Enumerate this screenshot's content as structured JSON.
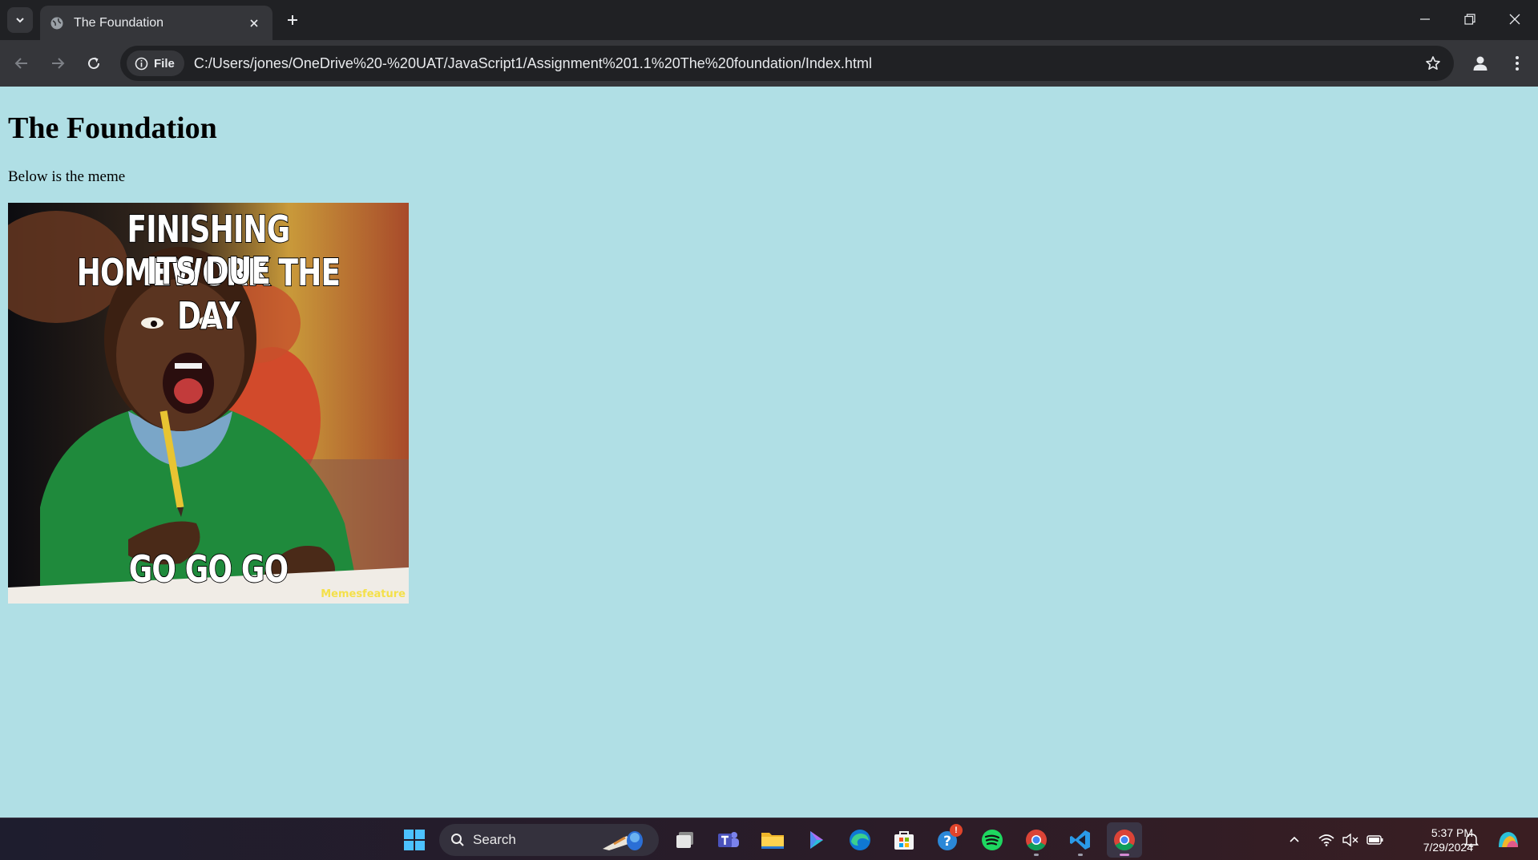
{
  "browser": {
    "tab_title": "The Foundation",
    "url_chip": "File",
    "url": "C:/Users/jones/OneDrive%20-%20UAT/JavaScript1/Assignment%201.1%20The%20foundation/Index.html",
    "icons": [
      "tab-search-icon",
      "globe-icon",
      "close-icon",
      "plus-icon",
      "minimize-icon",
      "restore-icon",
      "close-window-icon",
      "back-icon",
      "forward-icon",
      "reload-icon",
      "info-icon",
      "star-icon",
      "profile-icon",
      "menu-icon"
    ]
  },
  "page": {
    "heading": "The Foundation",
    "paragraph": "Below is the meme",
    "meme": {
      "top_line_1": "FINISHING HOMEWORK THE DAY",
      "top_line_2": "ITS DUE",
      "bottom_line": "GO GO GO",
      "watermark": "Memesfeature"
    }
  },
  "taskbar": {
    "search_label": "Search",
    "time": "5:37 PM",
    "date": "7/29/2024",
    "apps": [
      "windows-start",
      "file-explorer-preview",
      "task-view",
      "teams",
      "file-explorer",
      "copilot",
      "edge",
      "microsoft-store",
      "help",
      "spotify",
      "chrome",
      "vscode",
      "chrome-active"
    ],
    "help_badge": "!"
  }
}
